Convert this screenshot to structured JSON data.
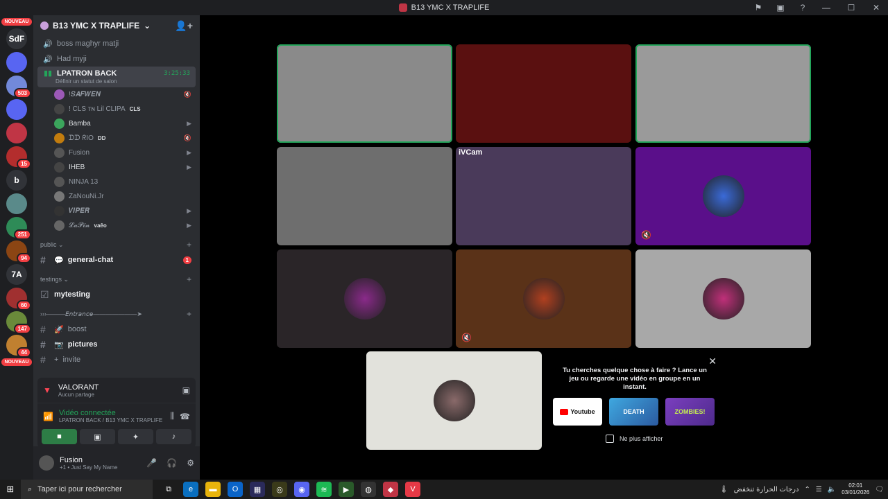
{
  "window": {
    "title": "B13 YMC X TRAPLIFE"
  },
  "rail": {
    "new_label": "NOUVEAU",
    "text_servers": [
      "SdF",
      "b",
      "7A"
    ],
    "badges": [
      "503",
      "15",
      "251",
      "94",
      "60",
      "147",
      "44"
    ]
  },
  "guild": {
    "name": "B13 YMC X TRAPLIFE"
  },
  "voice_channels_top": [
    "boss maghyr matji",
    "Had myji"
  ],
  "active_channel": {
    "name": "LPATRON BACK",
    "status_hint": "Définir un statut de salon",
    "timer": "3:25:33"
  },
  "members": [
    {
      "name": "!𝑺𝑨𝑭𝑾𝑬𝑵",
      "color": "#9b59b6"
    },
    {
      "name": "! CLS ᴛɴ Lil CLIPA",
      "tag": "CLS",
      "color": "#444"
    },
    {
      "name": "Bamba",
      "color": "#3ba55c"
    },
    {
      "name": "ᗪᗪ ᖇIO",
      "tag": "DD",
      "color": "#c27c0e"
    },
    {
      "name": "Fusion",
      "color": "#555"
    },
    {
      "name": "IHEB",
      "color": "#444"
    },
    {
      "name": "NINJA 13",
      "color": "#555"
    },
    {
      "name": "ZaNouNi.Jr",
      "color": "#777"
    },
    {
      "name": "𝑽𝑰𝑷𝑬𝑹",
      "color": "#333"
    },
    {
      "name": "𝓛𝓪𝓟𝓲𝓷",
      "tag": "vaêo",
      "color": "#666"
    }
  ],
  "categories": {
    "public": "public",
    "testings": "testings",
    "entrance": "›››———𝘌𝘯𝘵𝘳𝘢𝘯𝘤𝘦———————➤"
  },
  "text_channels": {
    "general_chat": "general-chat",
    "general_mentions": "1",
    "mytesting": "mytesting",
    "boost": "boost",
    "pictures": "pictures",
    "invite": "invite"
  },
  "activity": {
    "game": "VALORANT",
    "sub": "Aucun partage"
  },
  "voice_panel": {
    "status": "Vidéo connectée",
    "location": "LPATRON BACK / B13 YMC X TRAPLIFE"
  },
  "user": {
    "name": "Fusion",
    "status": "+1 • Just Say My Name"
  },
  "tiles": [
    {
      "label": "",
      "bg": "#8a8a8a",
      "speaking": true
    },
    {
      "label": "",
      "bg": "#5a1010",
      "speaking": false
    },
    {
      "label": "",
      "bg": "#9a9a9a",
      "speaking": true
    },
    {
      "label": "",
      "bg": "#6e6e6e",
      "speaking": false
    },
    {
      "label": "iVCam",
      "bg": "#4a3a5a",
      "speaking": false
    },
    {
      "label": "",
      "bg": "#5a0f8a",
      "speaking": false
    },
    {
      "label": "",
      "bg": "#2a2528",
      "speaking": false
    },
    {
      "label": "",
      "bg": "#5a3218",
      "speaking": false
    },
    {
      "label": "",
      "bg": "#a8a8a8",
      "speaking": false
    },
    {
      "label": "",
      "bg": "#e2e2dc",
      "speaking": false
    }
  ],
  "suggestion": {
    "message": "Tu cherches quelque chose à faire ? Lance un jeu ou regarde une vidéo en groupe en un instant.",
    "youtube": "Youtube",
    "card2": "DEATH",
    "card3": "ZOMBIES!",
    "checkbox_label": "Ne plus afficher"
  },
  "taskbar": {
    "search_placeholder": "Taper ici pour rechercher",
    "weather": "درجات الحرارة تنخفض",
    "time": "02:01",
    "date": "03/01/2026"
  }
}
